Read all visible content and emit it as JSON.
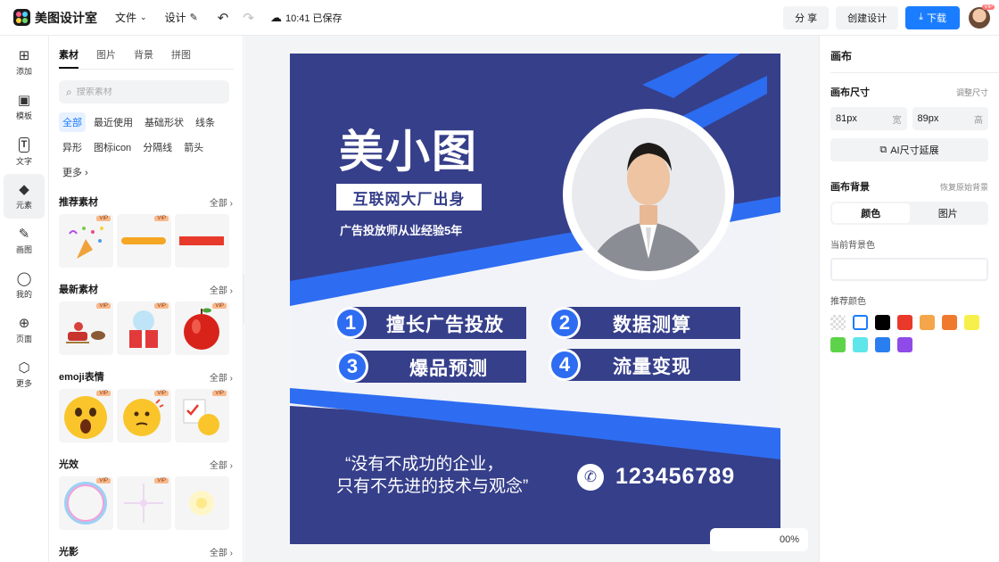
{
  "app": {
    "name": "美图设计室"
  },
  "topbar": {
    "menu_file": "文件",
    "menu_design": "设计",
    "saved_status": "10:41 已保存",
    "share": "分 享",
    "create": "创建设计",
    "download": "下载",
    "avatar_badge": "VIP"
  },
  "rail": [
    {
      "label": "添加",
      "icon": "⊞"
    },
    {
      "label": "模板",
      "icon": "▣"
    },
    {
      "label": "文字",
      "icon": "T"
    },
    {
      "label": "元素",
      "icon": "◆"
    },
    {
      "label": "画图",
      "icon": "✎"
    },
    {
      "label": "我的",
      "icon": "◯"
    },
    {
      "label": "页面",
      "icon": "⊕"
    },
    {
      "label": "更多",
      "icon": "⬡"
    }
  ],
  "panel": {
    "tabs": [
      "素材",
      "图片",
      "背景",
      "拼图"
    ],
    "search_placeholder": "搜索素材",
    "chips": [
      "全部",
      "最近使用",
      "基础形状",
      "线条",
      "异形",
      "图标icon",
      "分隔线",
      "箭头",
      "更多 ›"
    ],
    "all_label": "全部 ›",
    "vip": "VIP",
    "sections": [
      "推荐素材",
      "最新素材",
      "emoji表情",
      "光效",
      "光影"
    ]
  },
  "poster": {
    "title": "美小图",
    "subtitle": "互联网大厂出身",
    "experience": "广告投放师从业经验5年",
    "skills": [
      {
        "num": "1",
        "text": "擅长广告投放"
      },
      {
        "num": "2",
        "text": "数据测算"
      },
      {
        "num": "3",
        "text": "爆品预测"
      },
      {
        "num": "4",
        "text": "流量变现"
      }
    ],
    "quote_line1": "“没有不成功的企业，",
    "quote_line2": "只有不先进的技术与观念”",
    "phone": "123456789"
  },
  "zoom": "00%",
  "right": {
    "title": "画布",
    "size_label": "画布尺寸",
    "size_link": "调整尺寸",
    "width_value": "81px",
    "width_unit": "宽",
    "height_value": "89px",
    "height_unit": "高",
    "ai_extend": "AI尺寸延展",
    "bg_label": "画布背景",
    "bg_reset": "恢复原始背景",
    "seg_color": "颜色",
    "seg_image": "图片",
    "current_bg": "当前背景色",
    "recommend": "推荐颜色",
    "swatches": [
      "transparent",
      "#ffffff",
      "#000000",
      "#e8392b",
      "#f5a64a",
      "#ef7a2e",
      "#f8f04a",
      "#5dd34a",
      "#5fe6ea",
      "#2a7ff0",
      "#8f4be8"
    ]
  }
}
